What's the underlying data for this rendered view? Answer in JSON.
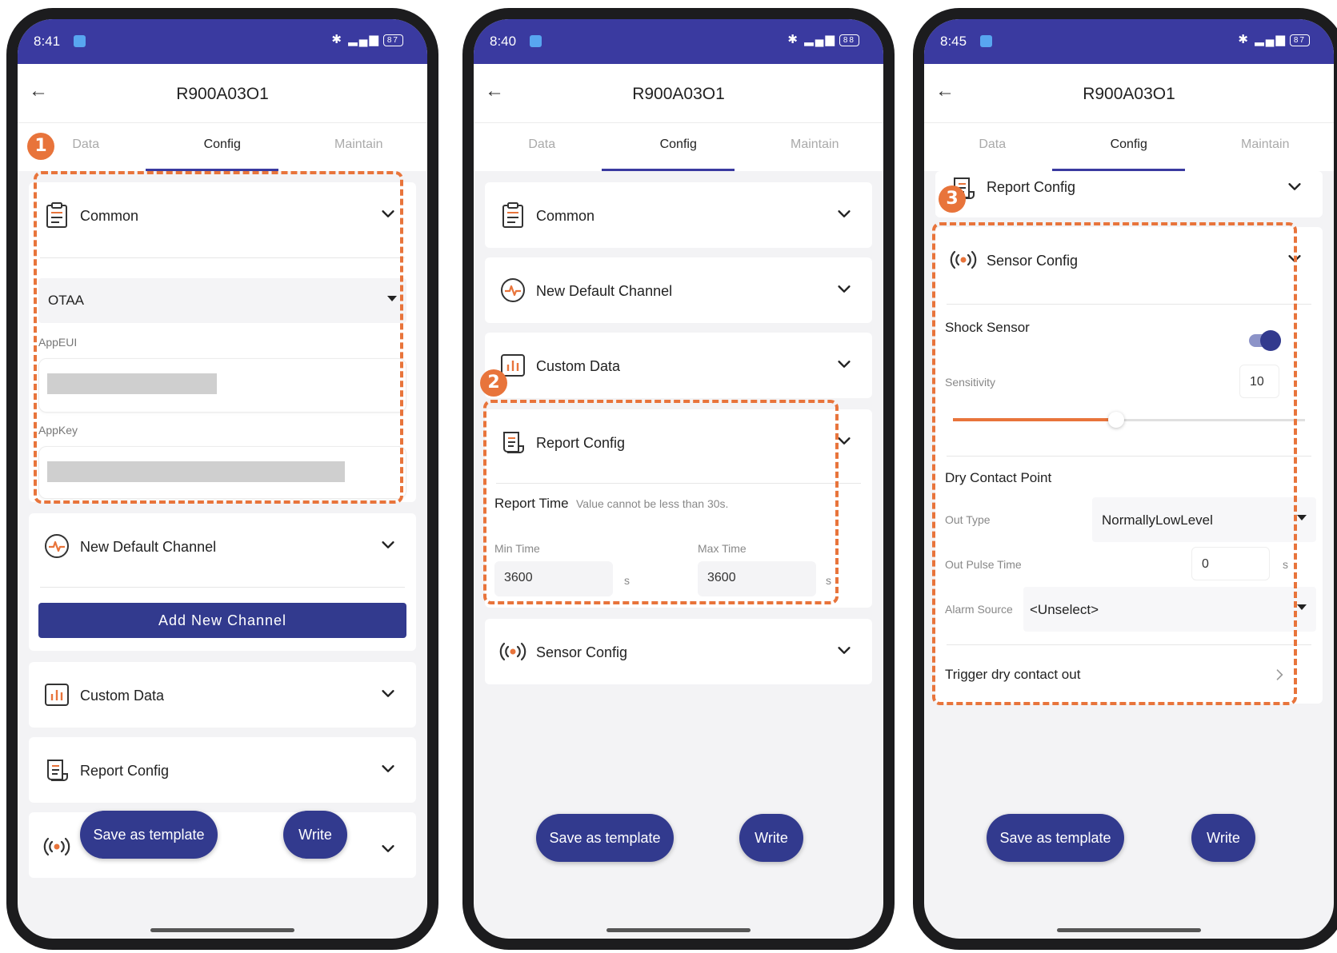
{
  "colors": {
    "status_bar": "#3a3aa0",
    "primary": "#323a8e",
    "annotation": "#e8743b"
  },
  "header": {
    "title": "R900A03O1"
  },
  "tabs": [
    "Data",
    "Config",
    "Maintain"
  ],
  "footer": {
    "save_template_label": "Save as template",
    "write_label": "Write"
  },
  "sections": {
    "common": "Common",
    "new_default_channel": "New Default Channel",
    "custom_data": "Custom Data",
    "report_config": "Report Config",
    "sensor_config": "Sensor Config"
  },
  "screen1": {
    "time": "8:41",
    "battery": "87",
    "step": "1",
    "join_mode": "OTAA",
    "appeui_label": "AppEUI",
    "appkey_label": "AppKey",
    "add_channel_label": "Add New Channel"
  },
  "screen2": {
    "time": "8:40",
    "battery": "88",
    "step": "2",
    "report_time_label": "Report Time",
    "report_time_hint": "Value cannot be less than 30s.",
    "min_time_label": "Min Time",
    "max_time_label": "Max Time",
    "min_time_value": "3600",
    "max_time_value": "3600",
    "unit": "s"
  },
  "screen3": {
    "time": "8:45",
    "battery": "87",
    "step": "3",
    "shock_sensor_label": "Shock Sensor",
    "shock_sensor_enabled": true,
    "sensitivity_label": "Sensitivity",
    "sensitivity_value": "10",
    "sensitivity_fraction": 0.45,
    "dry_contact_label": "Dry Contact Point",
    "out_type_label": "Out Type",
    "out_type_value": "NormallyLowLevel",
    "out_pulse_label": "Out Pulse Time",
    "out_pulse_value": "0",
    "unit": "s",
    "alarm_source_label": "Alarm Source",
    "alarm_source_value": "<Unselect>",
    "trigger_label": "Trigger dry contact out"
  }
}
